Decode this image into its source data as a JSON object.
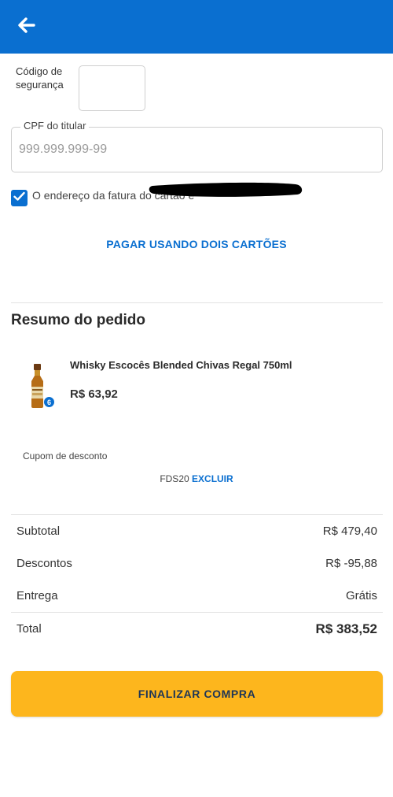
{
  "header": {
    "back_icon": "arrow-left-icon",
    "color": "#0a6fd0"
  },
  "payment_form": {
    "security_code_label": "Código de segurança",
    "security_code_value": "",
    "cpf_label": "CPF do titular",
    "cpf_placeholder": "999.999.999-99",
    "billing_address_checkbox_label": "O endereço da fatura do cartão é",
    "billing_address_checked": true,
    "two_cards_link": "PAGAR USANDO DOIS CARTÕES"
  },
  "order_summary": {
    "title": "Resumo do pedido",
    "items": [
      {
        "name": "Whisky Escocês Blended Chivas Regal 750ml",
        "price": "R$ 63,92",
        "quantity": "6",
        "image_icon": "whisky-bottle-icon"
      }
    ],
    "coupon_label": "Cupom de desconto",
    "coupon_code": "FDS20",
    "coupon_remove": "EXCLUIR",
    "rows": [
      {
        "label": "Subtotal",
        "value": "R$ 479,40"
      },
      {
        "label": "Descontos",
        "value": "R$ -95,88"
      },
      {
        "label": "Entrega",
        "value": "Grátis"
      }
    ],
    "total_label": "Total",
    "total_value": "R$ 383,52"
  },
  "finish_button": {
    "label": "FINALIZAR COMPRA",
    "color": "#fdb61d"
  },
  "colors": {
    "accent": "#0a6fd0",
    "button": "#fdb61d"
  }
}
